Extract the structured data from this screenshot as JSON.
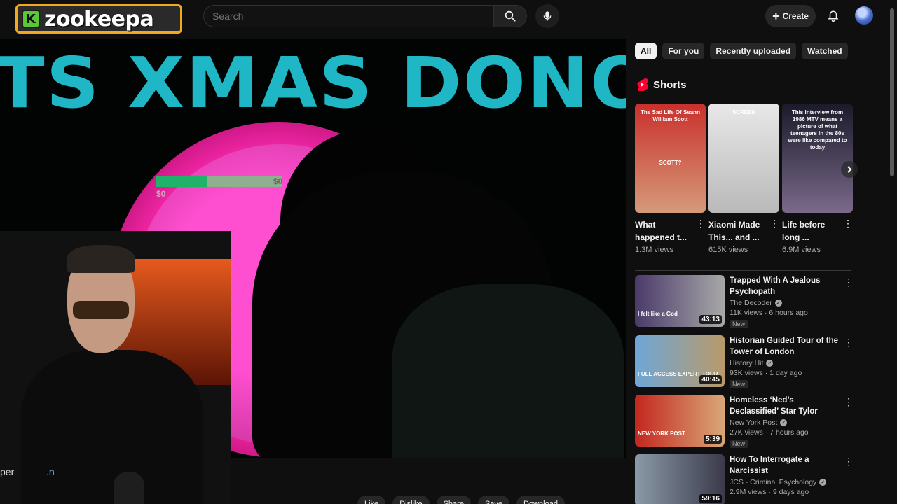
{
  "app": {
    "logo_letter": "K",
    "logo_text": "zookeepa",
    "search_placeholder": "Search",
    "create_label": "Create"
  },
  "video": {
    "overlay_title": "TS XMAS DONOS",
    "progress_amount": "$0",
    "progress_goal": "$0",
    "progress_fraction": 0.4,
    "channel_text_visible": "per",
    "channel_text_suffix": ".n"
  },
  "chips": [
    {
      "label": "All",
      "active": true
    },
    {
      "label": "For you",
      "active": false
    },
    {
      "label": "Recently uploaded",
      "active": false
    },
    {
      "label": "Watched",
      "active": false
    }
  ],
  "shorts": {
    "title": "Shorts",
    "items": [
      {
        "title": "What happened t...",
        "views": "1.3M views",
        "thumb_text": "The Sad Life Of Seann William Scott",
        "thumb_caption": "SCOTT?",
        "color_top": "#c9302c",
        "color_bottom": "#d59a7a"
      },
      {
        "title": "Xiaomi Made This... and ...",
        "views": "615K views",
        "thumb_text": "SCREEN",
        "thumb_caption": "",
        "color_top": "#e8e8e8",
        "color_bottom": "#b9b9b9"
      },
      {
        "title": "Life before long ...",
        "views": "6.9M views",
        "thumb_text": "This interview from 1986 MTV means a picture of what teenagers in the 80s were like compared to today",
        "thumb_caption": "",
        "color_top": "#1a1a2a",
        "color_bottom": "#7a6a8a"
      }
    ]
  },
  "videos": [
    {
      "title": "Trapped With A Jealous Psychopath",
      "channel": "The Decoder",
      "verified": true,
      "views": "11K views · 6 hours ago",
      "badge": "New",
      "duration": "43:13",
      "thumb_text": "I felt like a God",
      "thumb_a": "#4a3a6a",
      "thumb_b": "#a8a8a8"
    },
    {
      "title": "Historian Guided Tour of the Tower of London",
      "channel": "History Hit",
      "verified": true,
      "views": "93K views · 1 day ago",
      "badge": "New",
      "duration": "40:45",
      "thumb_text": "FULL ACCESS EXPERT TOUR",
      "thumb_a": "#6fa6d8",
      "thumb_b": "#b89a6a"
    },
    {
      "title": "Homeless ‘Ned’s Declassified’ Star Tylor Chase Hospitalized ...",
      "channel": "New York Post",
      "verified": true,
      "views": "27K views · 7 hours ago",
      "badge": "New",
      "duration": "5:39",
      "thumb_text": "NEW YORK POST",
      "thumb_a": "#c4261f",
      "thumb_b": "#d8a878"
    },
    {
      "title": "How To Interrogate a Narcissist",
      "channel": "JCS - Criminal Psychology",
      "verified": true,
      "views": "2.9M views · 9 days ago",
      "badge": "",
      "duration": "59:16",
      "thumb_text": "",
      "thumb_a": "#8a9aa8",
      "thumb_b": "#3a3a4a"
    }
  ],
  "action_row": [
    "Like",
    "Dislike",
    "Share",
    "Save",
    "Download"
  ],
  "icons": {
    "search": "search-icon",
    "mic": "mic-icon",
    "create": "plus-icon",
    "bell": "bell-icon",
    "shorts": "shorts-icon",
    "next": "chevron-right-icon",
    "menu": "more-vertical-icon"
  },
  "colors": {
    "accent_overlay": "#1fb7c6",
    "ring": "#ff2bb0",
    "shorts_red": "#ff0033"
  }
}
